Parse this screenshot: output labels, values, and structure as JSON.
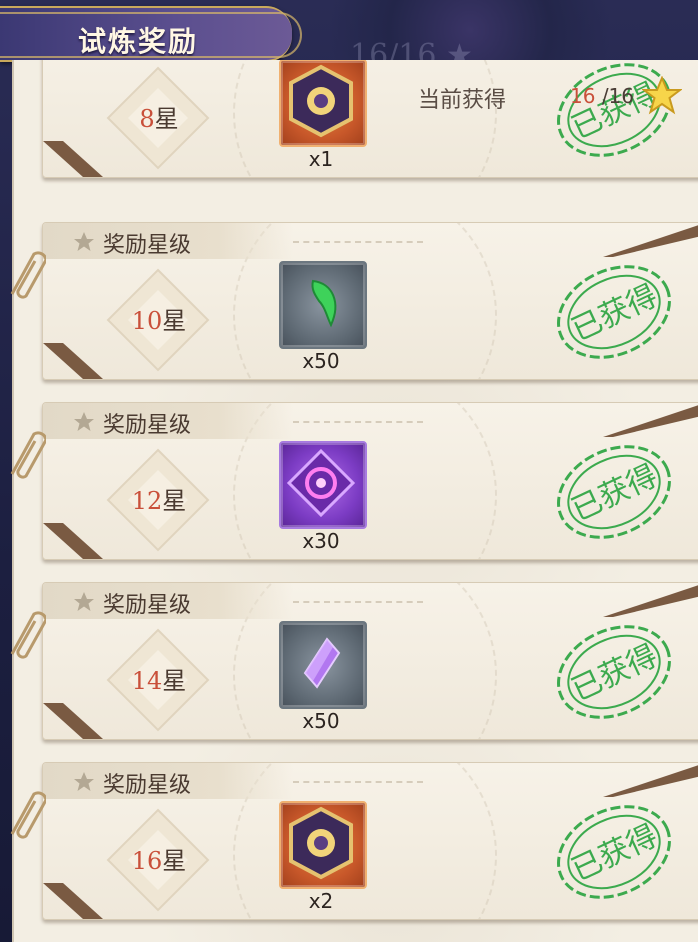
{
  "header": {
    "title": "试炼奖励"
  },
  "summary": {
    "label": "当前获得",
    "current": "16",
    "total": "/16",
    "star_icon": "star-icon"
  },
  "card_header_label": "奖励星级",
  "stamp_text": "已获得",
  "rewards": [
    {
      "level": "8",
      "unit": "星",
      "count": "x1",
      "item": "gold-emblem-icon",
      "box": "orange"
    },
    {
      "level": "10",
      "unit": "星",
      "count": "x50",
      "item": "green-crescent-icon",
      "box": "grey"
    },
    {
      "level": "12",
      "unit": "星",
      "count": "x30",
      "item": "purple-eye-emblem-icon",
      "box": "purple"
    },
    {
      "level": "14",
      "unit": "星",
      "count": "x50",
      "item": "purple-crystal-icon",
      "box": "grey"
    },
    {
      "level": "16",
      "unit": "星",
      "count": "x2",
      "item": "gold-emblem-icon",
      "box": "orange"
    }
  ],
  "colors": {
    "accent_red": "#c9503a",
    "stamp_green": "#3caa4e",
    "panel_bg": "#f3eee3"
  }
}
